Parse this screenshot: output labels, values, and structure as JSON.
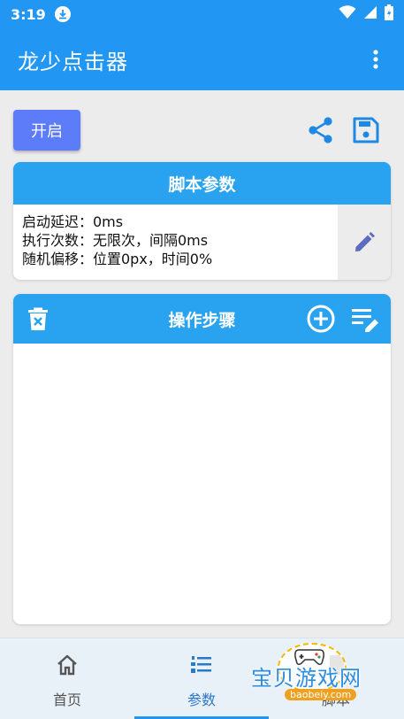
{
  "status_bar": {
    "time": "3:19"
  },
  "app_bar": {
    "title": "龙少点击器"
  },
  "toolbar": {
    "start_label": "开启"
  },
  "params_card": {
    "title": "脚本参数",
    "lines": [
      "启动延迟：0ms",
      "执行次数：无限次，间隔0ms",
      "随机偏移：位置0px，时间0%"
    ]
  },
  "steps_card": {
    "title": "操作步骤"
  },
  "bottom_nav": {
    "items": [
      {
        "label": "首页",
        "icon": "home-icon"
      },
      {
        "label": "参数",
        "icon": "list-numbered-icon"
      },
      {
        "label": "脚本",
        "icon": "script-icon"
      }
    ],
    "selected": "参数"
  },
  "watermark": {
    "text": "宝贝游戏网",
    "url": "baobeiy.com"
  },
  "colors": {
    "primary": "#2196f3",
    "card_header": "#29a3f0",
    "start_button": "#5c7cfa",
    "icon_blue": "#1e88e5",
    "edit_icon": "#5c6bc0",
    "nav_selected": "#2a78c8"
  }
}
